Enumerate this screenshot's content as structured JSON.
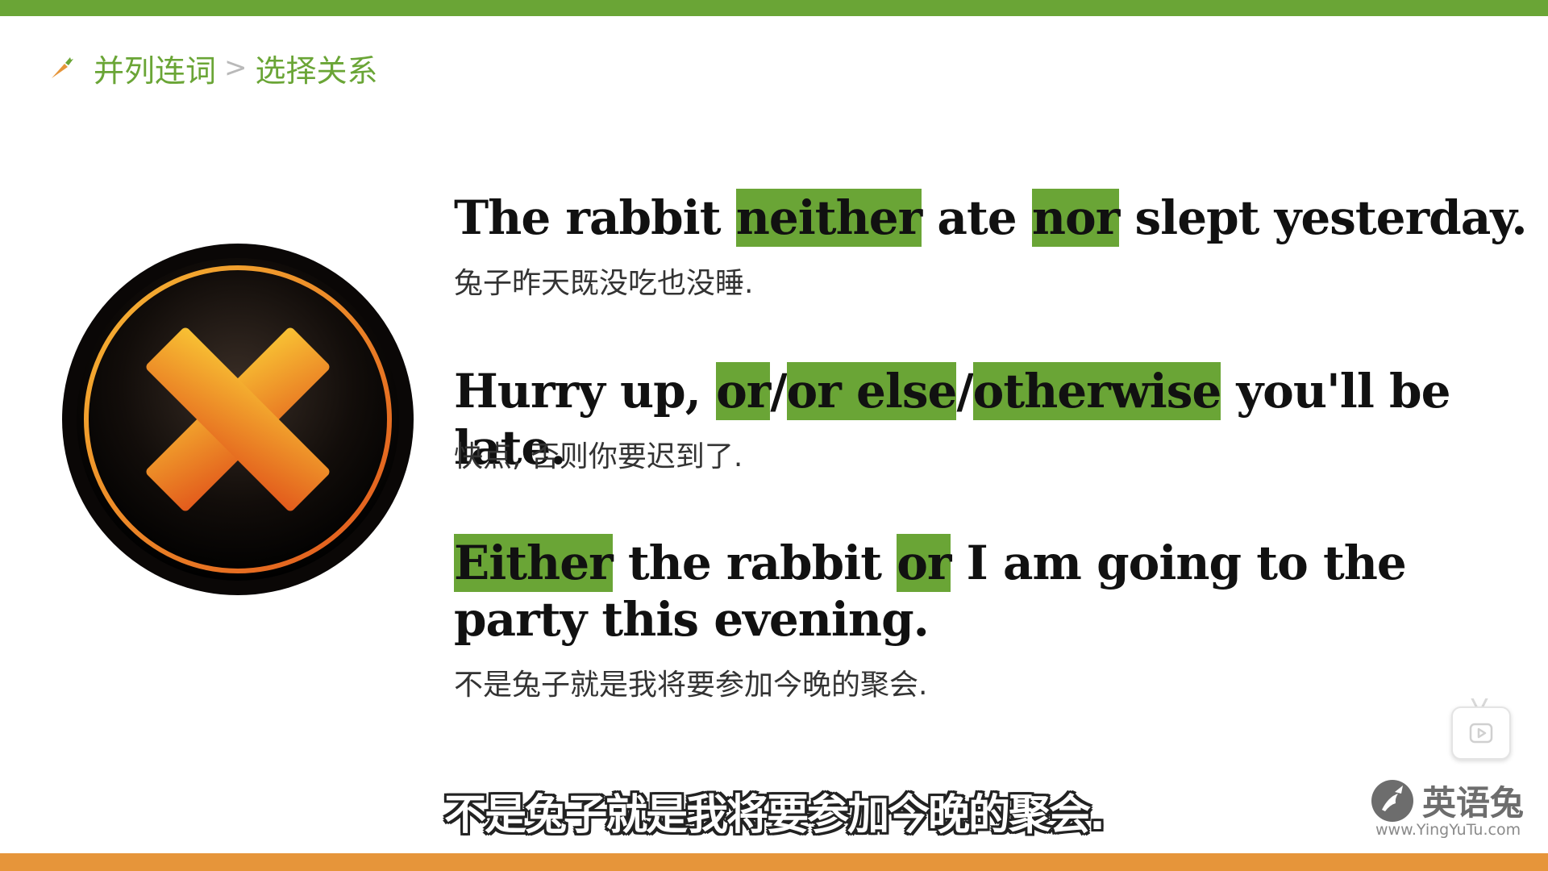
{
  "breadcrumb": {
    "parent": "并列连词",
    "separator": ">",
    "current": "选择关系",
    "icon": "carrot-icon"
  },
  "sentences": [
    {
      "segments": [
        {
          "text": "The rabbit ",
          "highlight": false
        },
        {
          "text": "neither",
          "highlight": true
        },
        {
          "text": " ate ",
          "highlight": false
        },
        {
          "text": "nor",
          "highlight": true
        },
        {
          "text": " slept yesterday.",
          "highlight": false
        }
      ],
      "translation": "兔子昨天既没吃也没睡."
    },
    {
      "segments": [
        {
          "text": "Hurry up, ",
          "highlight": false
        },
        {
          "text": "or",
          "highlight": true
        },
        {
          "text": "/",
          "highlight": false
        },
        {
          "text": "or else",
          "highlight": true
        },
        {
          "text": "/",
          "highlight": false
        },
        {
          "text": "otherwise",
          "highlight": true
        },
        {
          "text": " you'll be late.",
          "highlight": false
        }
      ],
      "translation": "快点, 否则你要迟到了."
    },
    {
      "segments": [
        {
          "text": "Either",
          "highlight": true
        },
        {
          "text": " the rabbit ",
          "highlight": false
        },
        {
          "text": "or",
          "highlight": true
        },
        {
          "text": " I am going to the party this evening.",
          "highlight": false
        }
      ],
      "translation": "不是兔子就是我将要参加今晚的聚会."
    }
  ],
  "subtitle": "不是兔子就是我将要参加今晚的聚会.",
  "watermark": {
    "brand": "英语兔",
    "url": "www.YingYuTu.com"
  },
  "icons": {
    "badge": "wrong-x-icon",
    "play": "play-icon"
  },
  "colors": {
    "accent_green": "#6aa536",
    "accent_orange": "#e6953a",
    "text": "#111111"
  }
}
